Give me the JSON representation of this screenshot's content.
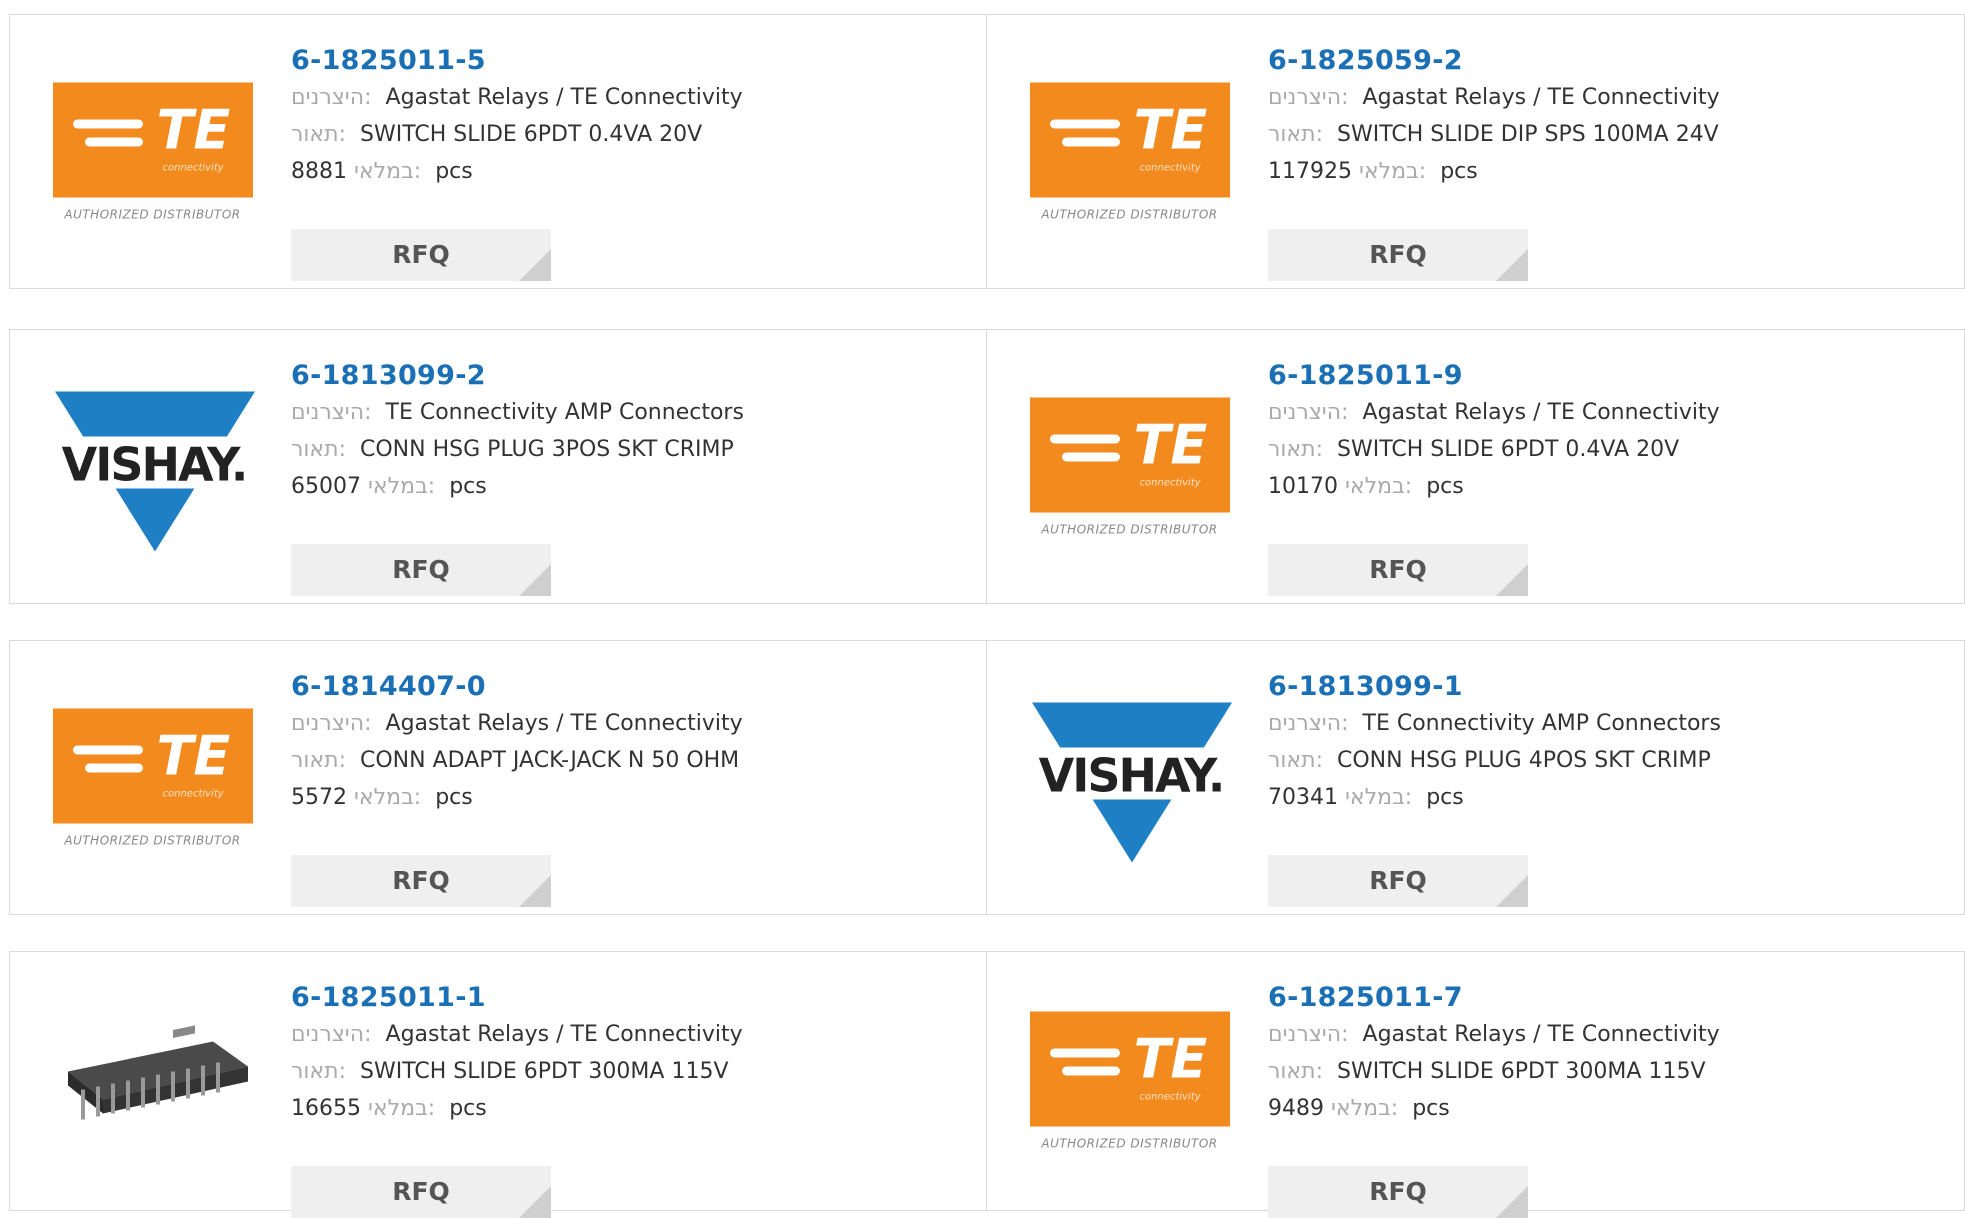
{
  "labels": {
    "manufacturer": "היצרנים:",
    "description": "תאור:",
    "stock": "במלאי:",
    "unit": "pcs",
    "rfq": "RFQ"
  },
  "brands": {
    "te": {
      "name": "TE",
      "sub": "connectivity",
      "tagline": "AUTHORIZED DISTRIBUTOR",
      "color": "#f28a1e"
    },
    "vishay": {
      "name": "VISHAY.",
      "color": "#1f7fc4"
    }
  },
  "products": [
    {
      "part": "6-1825011-5",
      "manufacturer": "Agastat Relays / TE Connectivity",
      "description": "SWITCH SLIDE 6PDT 0.4VA 20V",
      "stock": "8881",
      "logo": "te-logo"
    },
    {
      "part": "6-1825059-2",
      "manufacturer": "Agastat Relays / TE Connectivity",
      "description": "SWITCH SLIDE DIP SPS 100MA 24V",
      "stock": "117925",
      "logo": "te-logo"
    },
    {
      "part": "6-1813099-2",
      "manufacturer": "TE Connectivity AMP Connectors",
      "description": "CONN HSG PLUG 3POS SKT CRIMP",
      "stock": "65007",
      "logo": "vishay-logo"
    },
    {
      "part": "6-1825011-9",
      "manufacturer": "Agastat Relays / TE Connectivity",
      "description": "SWITCH SLIDE 6PDT 0.4VA 20V",
      "stock": "10170",
      "logo": "te-logo"
    },
    {
      "part": "6-1814407-0",
      "manufacturer": "Agastat Relays / TE Connectivity",
      "description": "CONN ADAPT JACK-JACK N 50 OHM",
      "stock": "5572",
      "logo": "te-logo"
    },
    {
      "part": "6-1813099-1",
      "manufacturer": "TE Connectivity AMP Connectors",
      "description": "CONN HSG PLUG 4POS SKT CRIMP",
      "stock": "70341",
      "logo": "vishay-logo"
    },
    {
      "part": "6-1825011-1",
      "manufacturer": "Agastat Relays / TE Connectivity",
      "description": "SWITCH SLIDE 6PDT 300MA 115V",
      "stock": "16655",
      "logo": "dip-chip-image"
    },
    {
      "part": "6-1825011-7",
      "manufacturer": "Agastat Relays / TE Connectivity",
      "description": "SWITCH SLIDE 6PDT 300MA 115V",
      "stock": "9489",
      "logo": "te-logo"
    }
  ]
}
